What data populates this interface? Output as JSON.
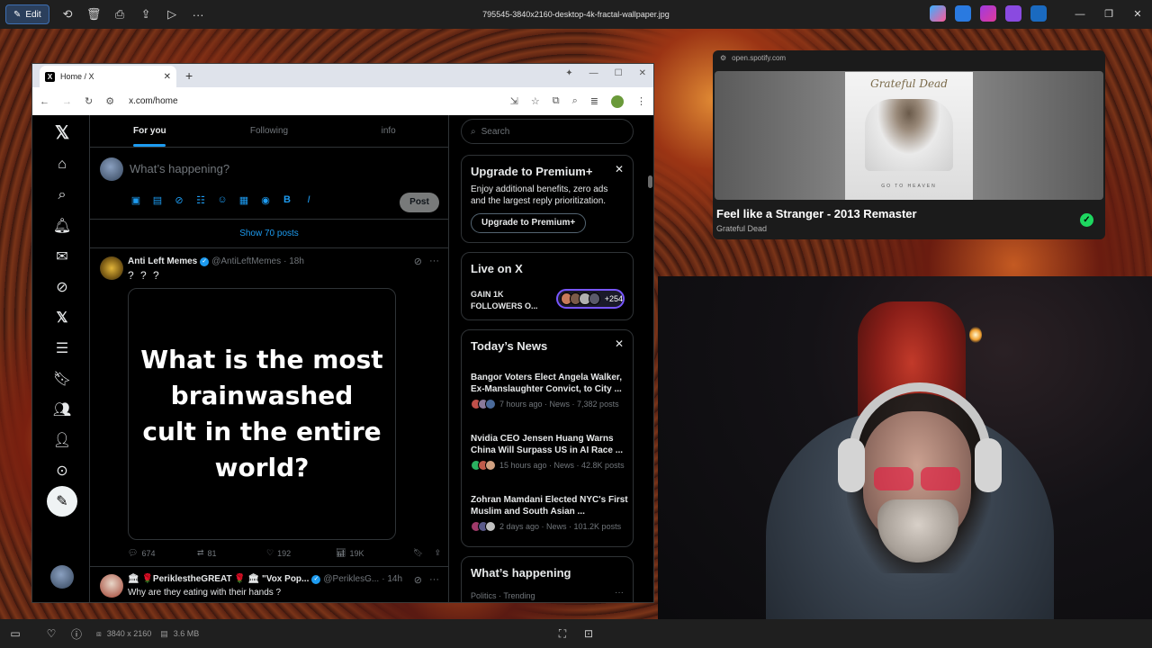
{
  "viewer": {
    "edit_label": "Edit",
    "filename": "795545-3840x2160-desktop-4k-fractal-wallpaper.jpg",
    "dimensions": "3840 x 2160",
    "filesize": "3.6 MB"
  },
  "browser": {
    "tab_title": "Home / X",
    "url": "x.com/home"
  },
  "x": {
    "tabs": [
      "For you",
      "Following",
      "info"
    ],
    "compose_placeholder": "What’s happening?",
    "post_label": "Post",
    "show_posts": "Show 70 posts",
    "tweet1": {
      "name": "Anti Left Memes",
      "handle": "@AntiLeftMemes",
      "time": "· 18h",
      "text": "? ? ?",
      "media_text": "What is the most brainwashed cult in the entire world?",
      "replies": "674",
      "reposts": "81",
      "likes": "192",
      "views": "19K"
    },
    "tweet2": {
      "name": "🏛 🌹PeriklestheGREAT 🌹 🏛 \"Vox Pop...",
      "handle": "@PeriklesG...",
      "time": "· 14h",
      "text": "Why are they eating with their hands ?"
    },
    "search_placeholder": "Search",
    "premium": {
      "title": "Upgrade to Premium+",
      "desc": "Enjoy additional benefits, zero ads and the largest reply prioritization.",
      "button": "Upgrade to Premium+"
    },
    "live": {
      "title": "Live on X",
      "text": "GAIN 1K FOLLOWERS O...",
      "count": "+254"
    },
    "news": {
      "title": "Today’s News",
      "items": [
        {
          "title": "Bangor Voters Elect Angela Walker, Ex-Manslaughter Convict, to City ...",
          "meta": "7 hours ago · News · 7,382 posts"
        },
        {
          "title": "Nvidia CEO Jensen Huang Warns China Will Surpass US in AI Race ...",
          "meta": "15 hours ago · News · 42.8K posts"
        },
        {
          "title": "Zohran Mamdani Elected NYC's First Muslim and South Asian ...",
          "meta": "2 days ago · News · 101.2K posts"
        }
      ]
    },
    "happening": {
      "title": "What’s happening",
      "meta": "Politics · Trending"
    }
  },
  "spotify": {
    "url": "open.spotify.com",
    "cover_title": "Grateful Dead",
    "cover_subtitle": "GO TO HEAVEN",
    "song": "Feel like a Stranger - 2013 Remaster",
    "artist": "Grateful Dead"
  }
}
